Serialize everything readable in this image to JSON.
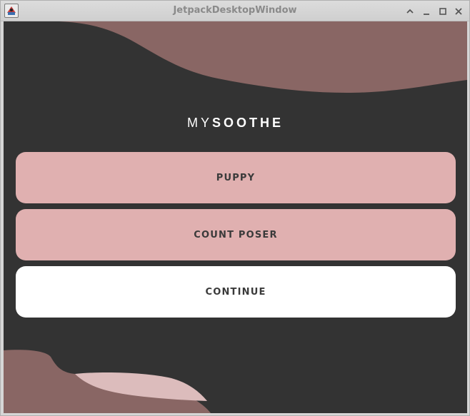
{
  "window": {
    "title": "JetpackDesktopWindow",
    "controls": [
      "minimize-chevron",
      "minimize",
      "maximize",
      "close"
    ]
  },
  "app": {
    "brand_light": "MY",
    "brand_bold": "SOOTHE",
    "buttons": [
      {
        "label": "PUPPY",
        "style": "pink"
      },
      {
        "label": "COUNT POSER",
        "style": "pink"
      },
      {
        "label": "CONTINUE",
        "style": "white"
      }
    ]
  },
  "colors": {
    "background": "#333333",
    "shape_dark": "#896664",
    "shape_light": "#dcbcbc",
    "button_pink": "#e0b0b0",
    "button_white": "#ffffff"
  }
}
